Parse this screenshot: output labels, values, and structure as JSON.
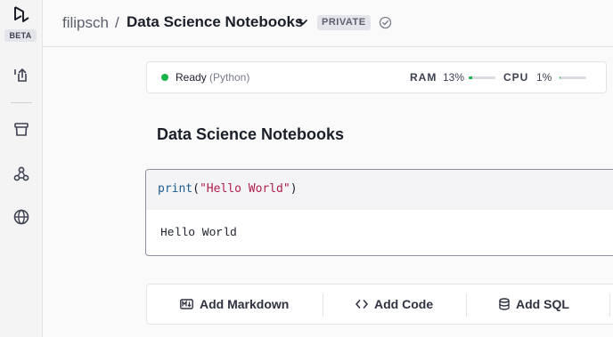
{
  "app": {
    "badge": "BETA"
  },
  "header": {
    "user": "filipsch",
    "separator": "/",
    "notebook_title": "Data Science Notebooks",
    "privacy": "PRIVATE"
  },
  "status": {
    "state": "Ready",
    "kernel": "(Python)",
    "ram_label": "RAM",
    "ram_value": "13%",
    "ram_fraction": 0.13,
    "cpu_label": "CPU",
    "cpu_value": "1%",
    "cpu_fraction": 0.01,
    "ok_color": "#19b34d"
  },
  "notebook": {
    "title": "Data Science Notebooks",
    "cell": {
      "code_fn": "print",
      "code_open": "(",
      "code_str": "\"Hello World\"",
      "code_close": ")",
      "output": "Hello World"
    }
  },
  "add_bar": {
    "markdown": "Add Markdown",
    "code": "Add Code",
    "sql": "Add SQL"
  },
  "icons": {
    "rail": [
      "upload-icon",
      "archive-icon",
      "integrations-icon",
      "globe-icon"
    ],
    "header": [
      "chevron-down-icon",
      "verified-icon"
    ],
    "add_bar": [
      "markdown-icon",
      "code-icon",
      "database-icon"
    ]
  }
}
